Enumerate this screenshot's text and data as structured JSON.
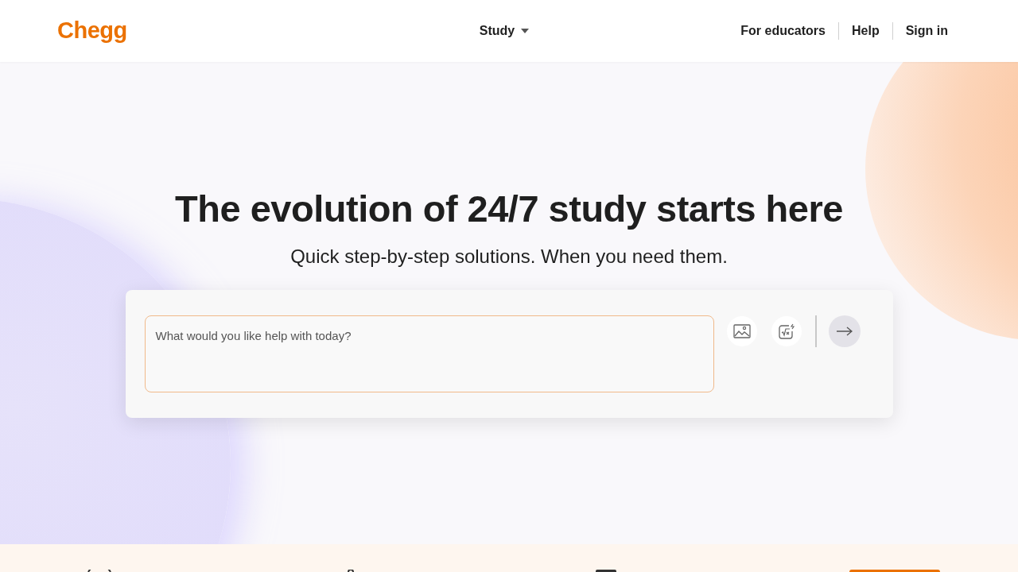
{
  "header": {
    "logo": "Chegg",
    "nav": [
      {
        "label": "Study",
        "kind": "dropdown"
      }
    ],
    "links": [
      "For educators",
      "Help",
      "Sign in"
    ]
  },
  "hero": {
    "title": "The evolution of 24/7 study starts here",
    "subtitle": "Quick step-by-step solutions. When you need them.",
    "search": {
      "placeholder": "What would you like help with today?"
    }
  }
}
